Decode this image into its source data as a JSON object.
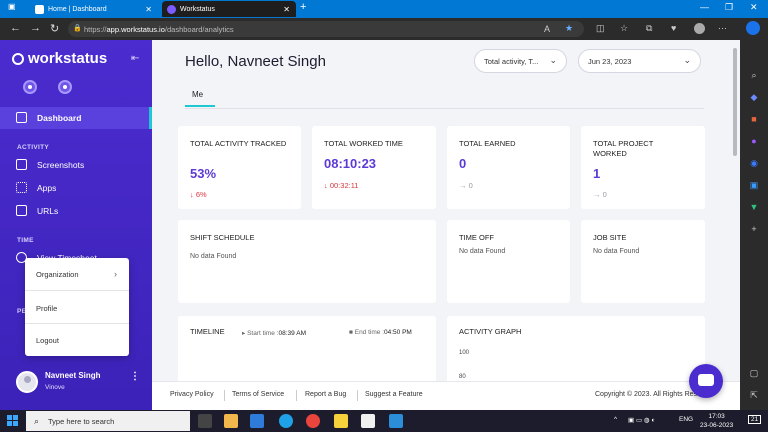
{
  "browser": {
    "tabs": [
      {
        "label": "Home | Dashboard",
        "active": false
      },
      {
        "label": "Workstatus",
        "active": true
      }
    ],
    "url_prefix": "https://",
    "url_domain": "app.workstatus.io",
    "url_path": "/dashboard/analytics"
  },
  "sidebar": {
    "brand": "workstatus",
    "dashboard": "Dashboard",
    "activity_section": "ACTIVITY",
    "screenshots": "Screenshots",
    "apps": "Apps",
    "urls": "URLs",
    "time_section": "TIME",
    "view_timesheet": "View Timesheet",
    "people_section": "PE",
    "user_name": "Navneet Singh",
    "user_org": "Vinove"
  },
  "popup": {
    "organization": "Organization",
    "profile": "Profile",
    "logout": "Logout"
  },
  "header": {
    "greeting": "Hello, Navneet Singh",
    "filter": "Total activity, T...",
    "date": "Jun 23, 2023",
    "tab_me": "Me"
  },
  "cards": {
    "activity": {
      "title": "TOTAL ACTIVITY TRACKED",
      "value": "53%",
      "delta": "6%"
    },
    "worked": {
      "title": "TOTAL WORKED TIME",
      "value": "08:10:23",
      "delta": "00:32:11"
    },
    "earned": {
      "title": "TOTAL EARNED",
      "value": "0",
      "delta": "0"
    },
    "projects": {
      "title": "TOTAL PROJECT WORKED",
      "value": "1",
      "delta": "0"
    },
    "shift": {
      "title": "SHIFT SCHEDULE",
      "empty": "No data Found"
    },
    "timeoff": {
      "title": "TIME OFF",
      "empty": "No data Found"
    },
    "jobsite": {
      "title": "JOB SITE",
      "empty": "No data Found"
    },
    "timeline": {
      "title": "TIMELINE",
      "start_label": "Start time :",
      "start": "08:39 AM",
      "end_label": "End time :",
      "end": "04:50 PM"
    },
    "activity_graph": {
      "title": "ACTIVITY GRAPH",
      "y1": "100",
      "y2": "80"
    }
  },
  "footer": {
    "privacy": "Privacy Policy",
    "terms": "Terms of Service",
    "report": "Report a Bug",
    "suggest": "Suggest a Feature",
    "copyright": "Copyright © 2023. All Rights Reserved"
  },
  "taskbar": {
    "search_placeholder": "Type here to search",
    "lang": "ENG",
    "time": "17:03",
    "date": "23-06-2023",
    "notif_count": "21"
  },
  "colors": {
    "brand": "#4b2ccf",
    "accent": "#1ec8d2",
    "value": "#5c3ad6",
    "down": "#d9363e"
  }
}
